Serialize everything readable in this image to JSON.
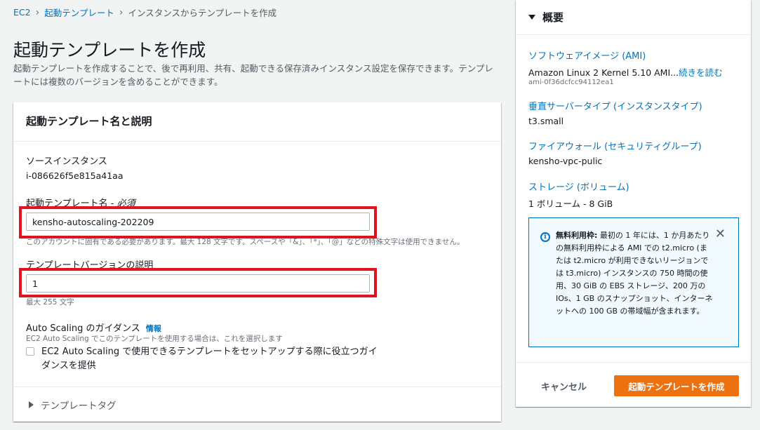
{
  "breadcrumb": {
    "items": [
      "EC2",
      "起動テンプレート"
    ],
    "current": "インスタンスからテンプレートを作成"
  },
  "page": {
    "title": "起動テンプレートを作成",
    "description": "起動テンプレートを作成することで、後で再利用、共有、起動できる保存済みインスタンス設定を保存できます。テンプレートには複数のバージョンを含めることができます。"
  },
  "panel": {
    "title": "起動テンプレート名と説明",
    "source_label": "ソースインスタンス",
    "source_value": "i-086626f5e815a41aa",
    "name_label": "起動テンプレート名 - ",
    "name_required": "必須",
    "name_value": "kensho-autoscaling-202209",
    "name_hint": "このアカウントに固有である必要があります。最大 128 文字です。スペースや「&」、「*」、「@」などの特殊文字は使用できません。",
    "version_label": "テンプレートバージョンの説明",
    "version_value": "1",
    "version_hint": "最大 255 文字",
    "asg_label": "Auto Scaling のガイダンス",
    "asg_info": "情報",
    "asg_hint": "EC2 Auto Scaling でこのテンプレートを使用する場合は、これを選択します",
    "asg_checkbox": "EC2 Auto Scaling で使用できるテンプレートをセットアップする際に役立つガイダンスを提供",
    "tags_label": "テンプレートタグ"
  },
  "summary": {
    "title": "概要",
    "ami_link": "ソフトウェアイメージ (AMI)",
    "ami_value": "Amazon Linux 2 Kernel 5.10 AMI...",
    "ami_more": "続きを読む",
    "ami_id": "ami-0f36dcfcc94112ea1",
    "type_link": "垂直サーバータイプ (インスタンスタイプ)",
    "type_value": "t3.small",
    "fw_link": "ファイアウォール (セキュリティグループ)",
    "fw_value": "kensho-vpc-pulic",
    "storage_link": "ストレージ (ボリューム)",
    "storage_value": "1 ボリューム - 8 GiB",
    "info_bold": "無料利用枠:",
    "info_text": " 最初の 1 年には、1 か月あたりの無料利用枠による AMI での t2.micro (または t2.micro が利用できないリージョンでは t3.micro) インスタンスの 750 時間の使用、30 GiB の EBS ストレージ、200 万の IOs、1 GB のスナップショット、インターネットへの 100 GB の帯域幅が含まれます。",
    "cancel": "キャンセル",
    "create": "起動テンプレートを作成"
  },
  "colors": {
    "accent": "#ec7211",
    "link": "#0073bb",
    "highlight": "#e0141e"
  }
}
